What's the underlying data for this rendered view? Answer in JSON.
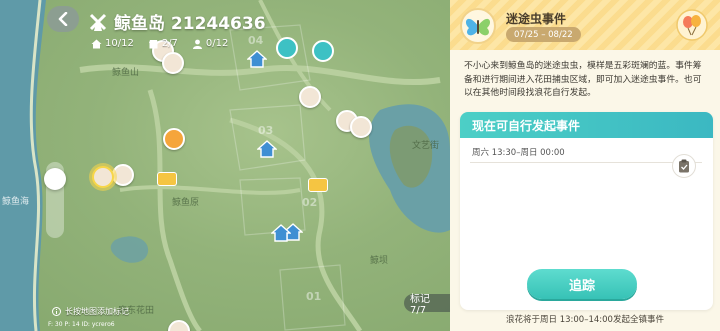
{
  "header": {
    "back_icon": "chevron-left-icon",
    "island_icon": "windmill-icon",
    "island_title": "鲸鱼岛 21244636",
    "stats": [
      {
        "icon": "house-icon",
        "value": "10/12"
      },
      {
        "icon": "shop-icon",
        "value": "2/7"
      },
      {
        "icon": "people-icon",
        "value": "0/12"
      }
    ]
  },
  "map": {
    "labels": {
      "whale_mountain": "鲸鱼山",
      "whale_sea": "鲸鱼海",
      "whale_plains": "鲸鱼原",
      "culture_station": "文艺街",
      "whale_mound": "鲸坝",
      "flower_garden": "庭东花田"
    },
    "zones": [
      "04",
      "03",
      "02",
      "01"
    ],
    "hint": "长按地图添加标记",
    "coords": "F: 30   P: 14   ID: ycrero6",
    "mark_label": "标记7/7"
  },
  "event": {
    "title": "迷途虫事件",
    "dates": "07/25 – 08/22",
    "description": "不小心来到鲸鱼岛的迷途虫虫，模样是五彩斑斓的蓝。事件筹备和进行期间进入花田捕虫区域，即可加入迷途虫事件。也可以在其他时间段找浪花自行发起。",
    "card_title": "现在可自行发起事件",
    "time_slot": "周六 13:30–周日 00:00",
    "track_button": "追踪",
    "footer_note": "浪花将于周日 13:00–14:00发起全镇事件"
  },
  "colors": {
    "accent_teal": "#3bb8c2",
    "header_yellow": "#fde6a6",
    "date_badge": "#c9a96f"
  }
}
